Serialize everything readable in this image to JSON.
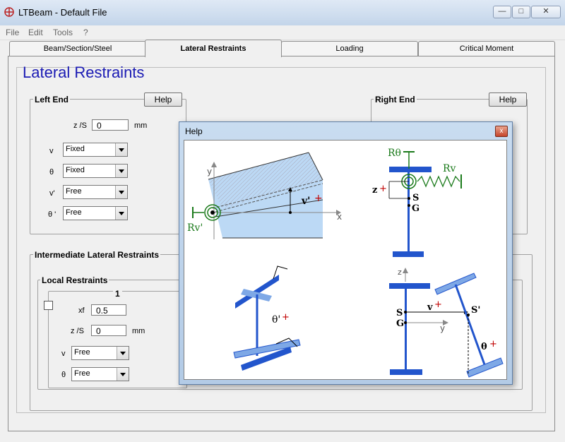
{
  "window": {
    "title": "LTBeam - Default File",
    "min": "—",
    "max": "□",
    "close": "✕"
  },
  "menu": [
    "File",
    "Edit",
    "Tools",
    "?"
  ],
  "tabs": [
    "Beam/Section/Steel",
    "Lateral Restraints",
    "Loading",
    "Critical Moment"
  ],
  "page_title": "Lateral Restraints",
  "left_end": {
    "title": "Left End",
    "help": "Help",
    "z_label": "z /S",
    "z_value": "0",
    "z_unit": "mm",
    "rows": [
      {
        "label": "v",
        "value": "Fixed"
      },
      {
        "label": "θ",
        "value": "Fixed"
      },
      {
        "label": "v'",
        "value": "Free"
      },
      {
        "label": "θ '",
        "value": "Free"
      }
    ]
  },
  "right_end": {
    "title": "Right End",
    "help": "Help"
  },
  "intermediate": {
    "title": "Intermediate Lateral Restraints",
    "local_title": "Local Restraints",
    "column_number": "1",
    "xf_label": "xf",
    "xf_value": "0.5",
    "z_label": "z /S",
    "z_value": "0",
    "z_unit": "mm",
    "v_label": "v",
    "v_value": "Free",
    "theta_label": "θ",
    "theta_value": "Free"
  },
  "help_dialog": {
    "title": "Help",
    "close": "x",
    "labels": {
      "y_axis_1": "y",
      "x_axis_1": "x",
      "v_prime": "v'",
      "r_v_prime": "Rv'",
      "r_theta": "Rθ",
      "r_v": "Rv",
      "z_label": "z",
      "s_label": "S",
      "g_label": "G",
      "theta_prime": "θ'",
      "z_axis": "z",
      "s2": "S",
      "g2": "G",
      "v2": "v",
      "y2": "y",
      "s_prime": "S'",
      "theta": "θ",
      "plus": "+"
    }
  },
  "colors": {
    "title_blue": "#1b1bb4",
    "plus_red": "#c00000",
    "spring_green": "#1a7a1a",
    "beam_blue": "#2255cc"
  }
}
